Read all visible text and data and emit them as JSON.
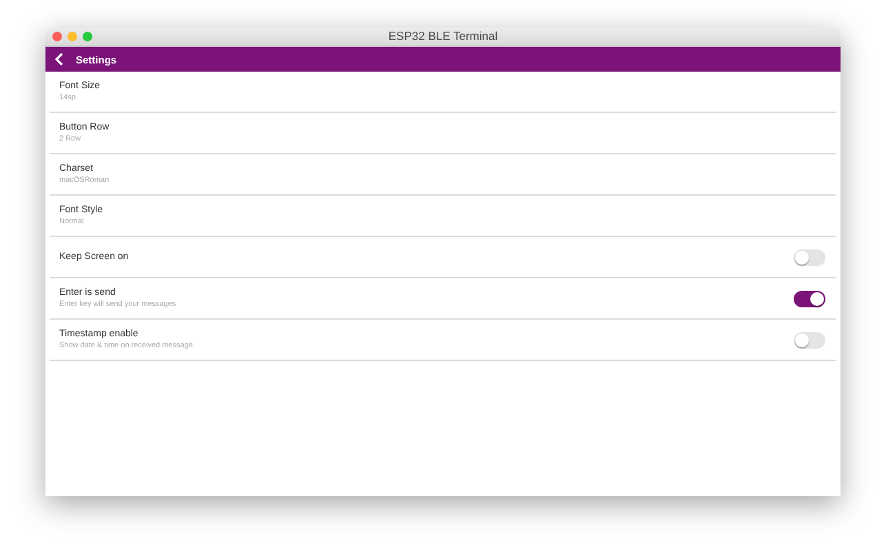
{
  "window": {
    "title": "ESP32 BLE Terminal"
  },
  "toolbar": {
    "title": "Settings"
  },
  "settings": [
    {
      "kind": "value",
      "label": "Font Size",
      "detail": "14sp"
    },
    {
      "kind": "value",
      "label": "Button Row",
      "detail": "2 Row"
    },
    {
      "kind": "value",
      "label": "Charset",
      "detail": "macOSRoman"
    },
    {
      "kind": "value",
      "label": "Font Style",
      "detail": "Normal"
    },
    {
      "kind": "switch",
      "label": "Keep Screen on",
      "on": false
    },
    {
      "kind": "switch",
      "label": "Enter is send",
      "detail": "Enter key will send your messages",
      "on": true
    },
    {
      "kind": "switch",
      "label": "Timestamp enable",
      "detail": "Show date & time on received message",
      "on": false
    }
  ]
}
